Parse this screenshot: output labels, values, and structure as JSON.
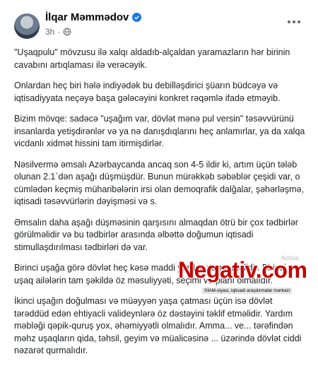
{
  "post": {
    "author": "İlqar Məmmədov",
    "time": "3h",
    "paragraphs": [
      "\"Uşaqpulu\" mövzusu ilə xalqı aldadıb-alçaldan yaramazların hər birinin cavabını artıqlaması ilə verəcəyik.",
      "Onlardan heç biri hələ indiyədək bu debilləşdirici şüarın büdcəyə və iqtisadiyyata neçəyə başa gələcəyini konkret rəqəmlə ifadə etməyib.",
      "Bizim mövqe: sadəcə \"uşağım var, dövlət mənə pul versin\" təsəvvürünü insanlarda yetişdirənlər və ya nə danışdıqlarını heç anlamırlar, ya da xalqa vicdanlı xidmət hissini tam itirmişdirlər.",
      "Nəsilvermə əmsalı Azərbaycanda ancaq son 4-5 ildir ki, artım üçün tələb olunan 2.1`dən aşağı düşmüşdür. Bunun mürəkkəb səbəblər çeşidi var, o cümlədən keçmiş müharibələrin irsi olan demoqrafik dalğalar, şəhərləşmə, iqtisadi təsəvvürlərin dəyişməsi və s.",
      "Əmsalın daha aşağı düşməsinin qarşısını almaqdan ötrü bir çox tədbirlər görülməlidir və bu tədbirlər arasında əlbəttə doğumun iqtisadi stimullaşdırılması tədbirləri də var.",
      "Birinci uşağa görə dövlət heç kəsə maddi yardım verməməlidir. Birinci uşaq ailələrin tam şəkildə öz məsuliyyəti, seçimi və planı olmalıdır.",
      "İkinci uşağın doğulması və müəyyən yaşa çatması üçün isə dövlət tərəddüd edən ehtiyacli valideynlərə öz dəstəyini təklif etməlidir. Yardım məbləği qəpik-quruş yox, əhəmiyyətli olmalıdır. Amma... ve... tərəfindən məhz uşaqların qida, təhsil, geyim və müalicəsinə ... üzərində dövlət ciddi nəzarət qurmalıdır."
    ]
  },
  "overlay": {
    "watermark": "Negativ.com",
    "ghost_text": "Activa",
    "caption": "SİAM-siyasi, iqtisadi araşdırmalar mərkəzi"
  },
  "colors": {
    "verified": "#1877f2",
    "watermark": "#c40000"
  },
  "icons": [
    "verified-badge-icon",
    "globe-icon",
    "more-options-icon"
  ]
}
